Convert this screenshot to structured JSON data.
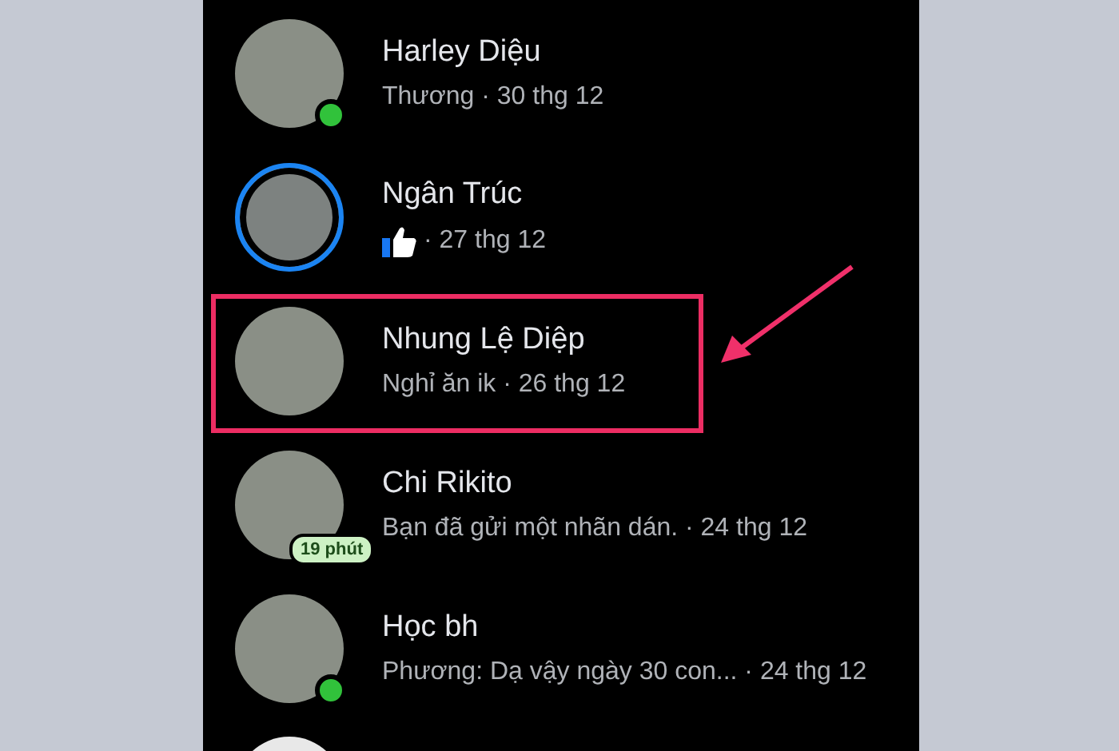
{
  "conversations": [
    {
      "name": "Harley Diệu",
      "kind": "text",
      "subtitle": "Thương · 30 thg 12",
      "online": true,
      "story_ring": false,
      "highlighted": false
    },
    {
      "name": "Ngân Trúc",
      "kind": "like",
      "subtitle": "· 27 thg 12",
      "online": false,
      "story_ring": true,
      "highlighted": false
    },
    {
      "name": "Nhung Lệ Diệp",
      "kind": "text",
      "subtitle": "Nghỉ ăn ik · 26 thg 12",
      "online": false,
      "story_ring": false,
      "highlighted": true
    },
    {
      "name": "Chi Rikito",
      "kind": "text",
      "subtitle": "Bạn đã gửi một nhãn dán. · 24 thg 12",
      "online": false,
      "story_ring": false,
      "highlighted": false,
      "badge": "19 phút"
    },
    {
      "name": "Học bh",
      "kind": "text",
      "subtitle": "Phương: Dạ vậy ngày 30 con... · 24 thg 12",
      "online": true,
      "story_ring": false,
      "highlighted": false
    }
  ]
}
